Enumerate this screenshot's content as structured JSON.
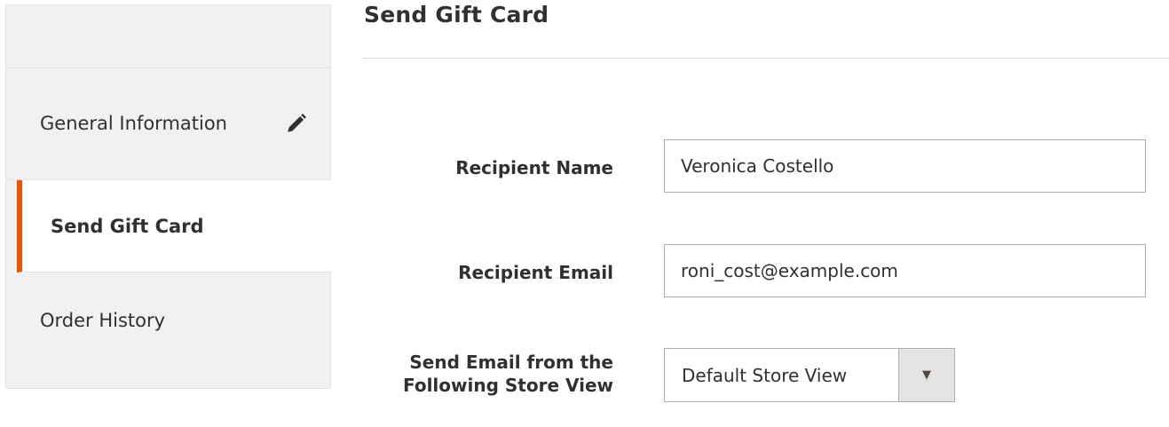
{
  "sidebar": {
    "items": [
      {
        "label": "General Information",
        "icon": "pencil-icon"
      },
      {
        "label": "Send Gift Card",
        "active": true
      },
      {
        "label": "Order History"
      }
    ],
    "accent_color": "#eb5202"
  },
  "main": {
    "title": "Send Gift Card",
    "fields": {
      "recipient_name": {
        "label": "Recipient Name",
        "value": "Veronica Costello"
      },
      "recipient_email": {
        "label": "Recipient Email",
        "value": "roni_cost@example.com"
      },
      "store_view": {
        "label": "Send Email from the Following Store View",
        "value": "Default Store View",
        "arrow": "▼"
      }
    }
  }
}
